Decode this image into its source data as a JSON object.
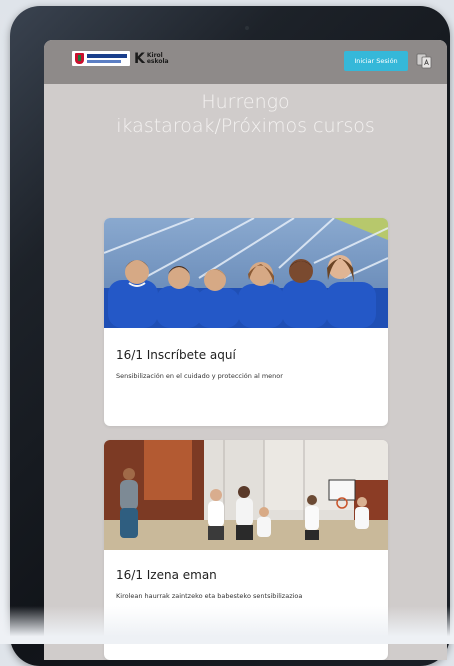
{
  "header": {
    "logo_kirol_line1": "Kirol",
    "logo_kirol_line2": "eskola",
    "login_label": "Iniciar Sesión"
  },
  "hero": {
    "title": "Hurrengo ikastaroak/Próximos cursos"
  },
  "courses": [
    {
      "title": "16/1 Inscríbete aquí",
      "description": "Sensibilización en el cuidado y protección al menor",
      "image": "children-running-track-photo"
    },
    {
      "title": "16/1 Izena eman",
      "description": "Kirolean haurrak zaintzeko eta babesteko sentsibilizazioa",
      "image": "children-gym-basketball-photo"
    }
  ],
  "colors": {
    "topbar": "#8e8a89",
    "background": "#d0cccb",
    "button": "#35b8d9",
    "tablet_bezel": "#15191e"
  }
}
